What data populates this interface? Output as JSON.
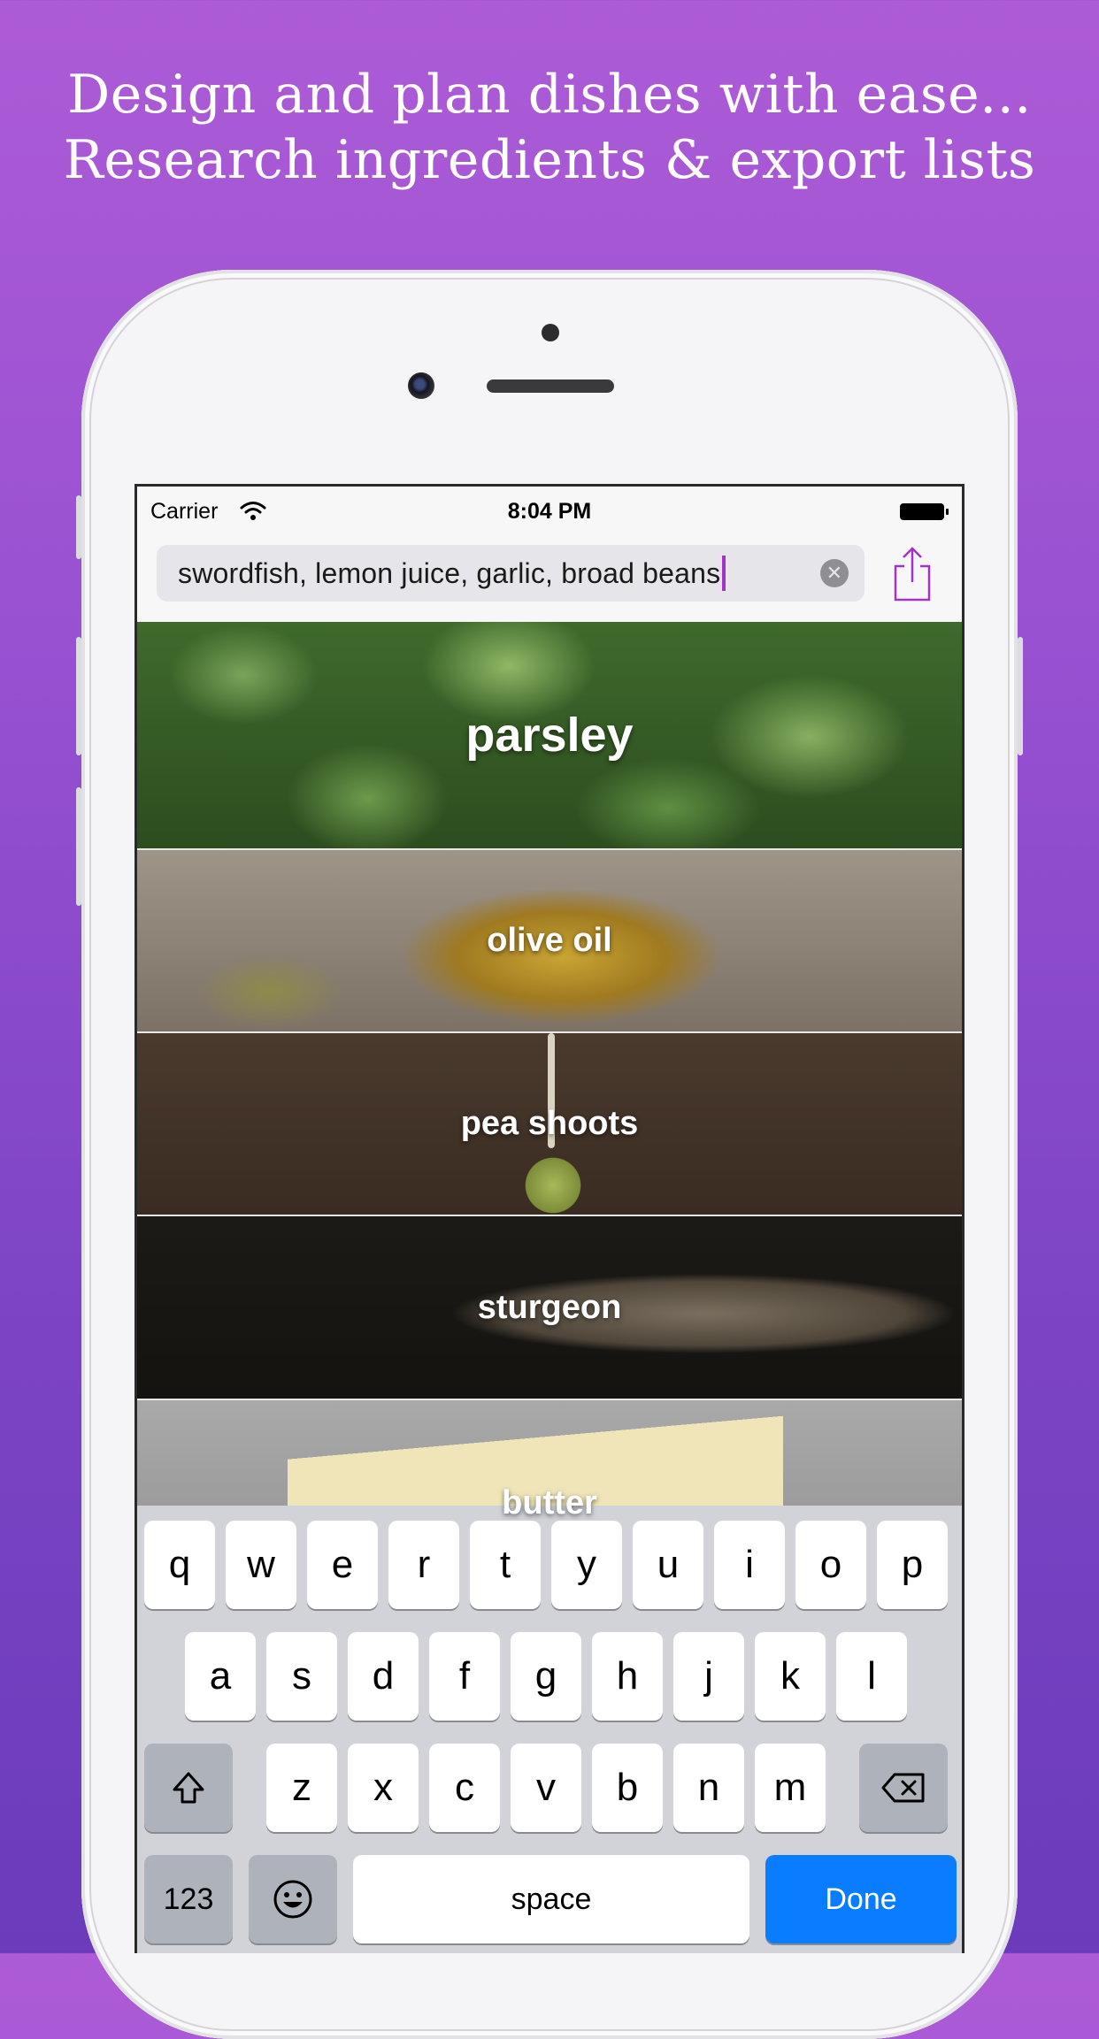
{
  "headline": {
    "line1": "Design and plan dishes with ease...",
    "line2": "Research ingredients & export lists"
  },
  "status_bar": {
    "carrier": "Carrier",
    "time": "8:04 PM"
  },
  "search": {
    "value": "swordfish, lemon juice, garlic, broad beans"
  },
  "ingredients": [
    {
      "label": "parsley"
    },
    {
      "label": "olive oil"
    },
    {
      "label": "pea shoots"
    },
    {
      "label": "sturgeon"
    },
    {
      "label": "butter"
    }
  ],
  "keyboard": {
    "row1": [
      "q",
      "w",
      "e",
      "r",
      "t",
      "y",
      "u",
      "i",
      "o",
      "p"
    ],
    "row2": [
      "a",
      "s",
      "d",
      "f",
      "g",
      "h",
      "j",
      "k",
      "l"
    ],
    "row3": [
      "z",
      "x",
      "c",
      "v",
      "b",
      "n",
      "m"
    ],
    "numbers_label": "123",
    "space_label": "space",
    "done_label": "Done"
  },
  "colors": {
    "caret": "#a233c9",
    "share_icon": "#a233c9",
    "done_key": "#0a7cff"
  },
  "icons": [
    "wifi-icon",
    "battery-icon",
    "clear-icon",
    "share-icon",
    "shift-icon",
    "backspace-icon",
    "emoji-icon"
  ]
}
